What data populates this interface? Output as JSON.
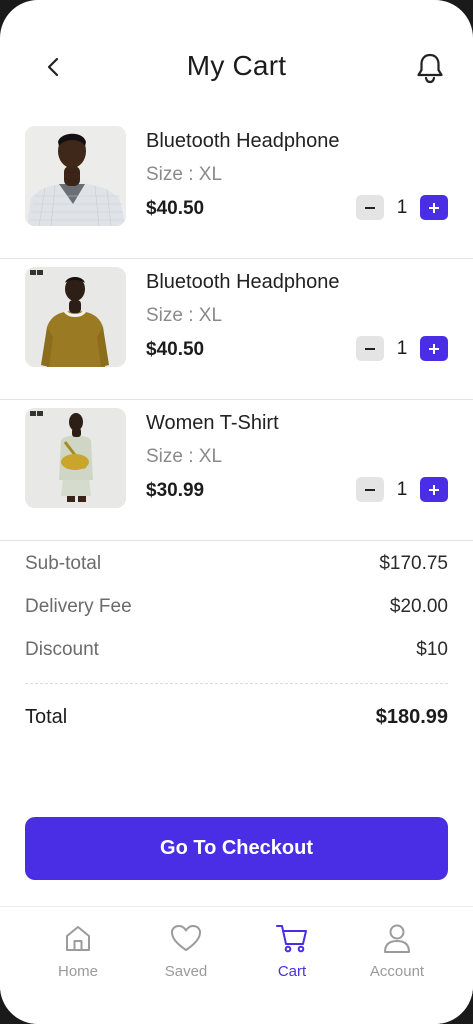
{
  "header": {
    "title": "My Cart"
  },
  "items": [
    {
      "name": "Bluetooth Headphone",
      "size": "Size : XL",
      "price": "$40.50",
      "qty": "1"
    },
    {
      "name": "Bluetooth Headphone",
      "size": "Size : XL",
      "price": "$40.50",
      "qty": "1"
    },
    {
      "name": "Women T-Shirt",
      "size": "Size : XL",
      "price": "$30.99",
      "qty": "1"
    }
  ],
  "summary": {
    "subtotal_label": "Sub-total",
    "subtotal_value": "$170.75",
    "delivery_label": "Delivery Fee",
    "delivery_value": "$20.00",
    "discount_label": "Discount",
    "discount_value": "$10",
    "total_label": "Total",
    "total_value": "$180.99"
  },
  "checkout": {
    "label": "Go To Checkout"
  },
  "tabs": [
    {
      "label": "Home",
      "icon": "home-icon"
    },
    {
      "label": "Saved",
      "icon": "heart-icon"
    },
    {
      "label": "Cart",
      "icon": "cart-icon"
    },
    {
      "label": "Account",
      "icon": "user-icon"
    }
  ],
  "colors": {
    "accent": "#4a2ee6",
    "muted": "#9b9b9b",
    "text": "#1c1c1c"
  }
}
